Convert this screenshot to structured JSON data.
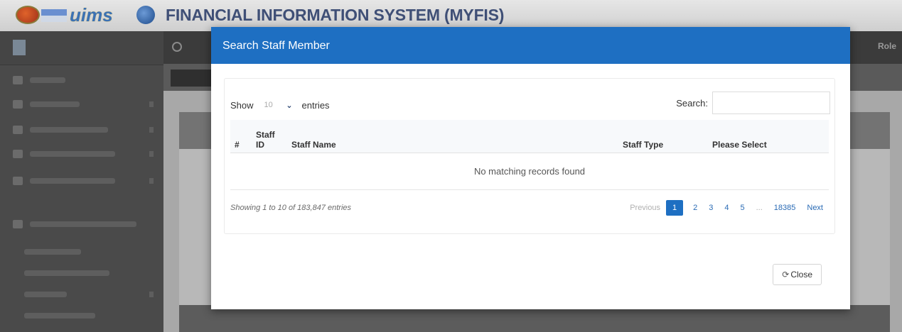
{
  "header": {
    "logo_text": "uims",
    "app_title": "FINANCIAL INFORMATION SYSTEM (MYFIS)"
  },
  "topbar": {
    "role_label": "Role"
  },
  "modal": {
    "title": "Search Staff Member",
    "show_label": "Show",
    "entries_label": "entries",
    "length_value": "10",
    "search_label": "Search:",
    "search_value": "",
    "columns": [
      "#",
      "Staff ID",
      "Staff Name",
      "Staff Type",
      "Please Select"
    ],
    "empty_message": "No matching records found",
    "info_text": "Showing 1 to 10 of 183,847 entries",
    "pagination": {
      "previous": "Previous",
      "pages": [
        "1",
        "2",
        "3",
        "4",
        "5"
      ],
      "ellipsis": "...",
      "last_page": "18385",
      "next": "Next",
      "current": "1"
    },
    "close_label": "Close"
  },
  "colors": {
    "modal_header": "#1e6fc2",
    "active_page": "#1e6fc2",
    "link": "#2a6bb5"
  }
}
